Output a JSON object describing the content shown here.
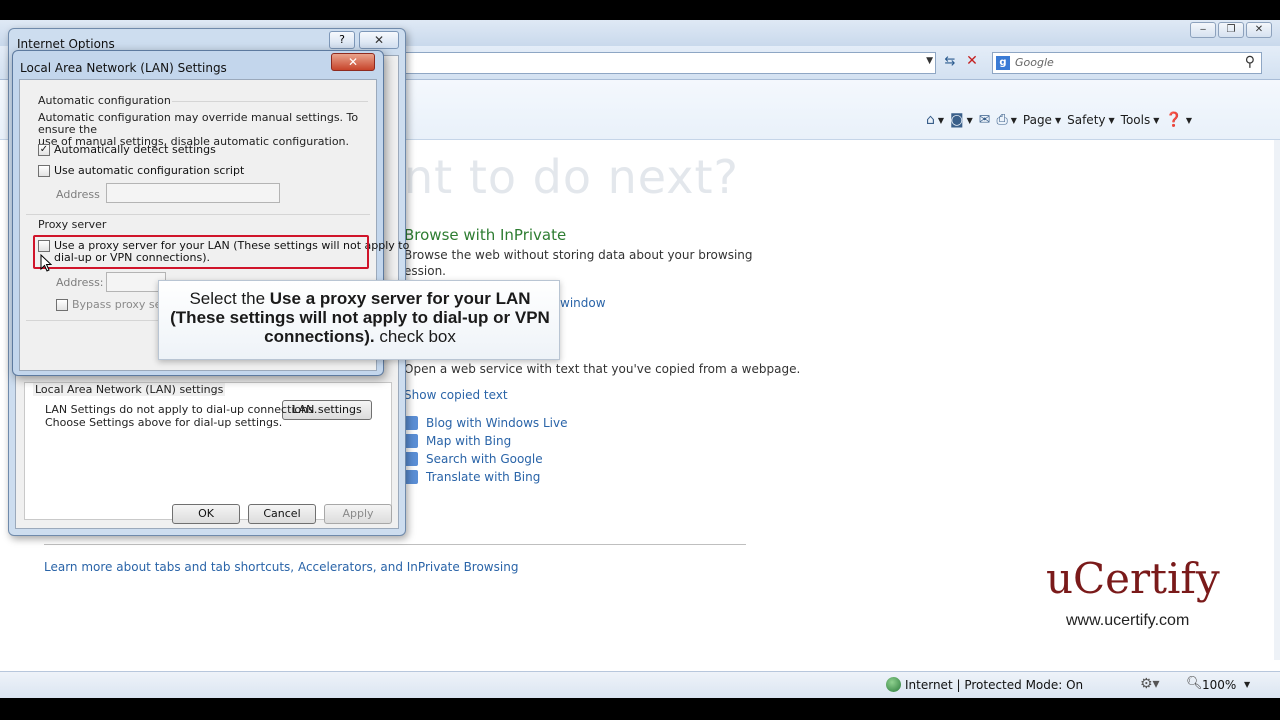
{
  "browser": {
    "search_placeholder": "Google",
    "command_bar": {
      "page_label": "Page",
      "safety_label": "Safety",
      "tools_label": "Tools"
    },
    "content": {
      "big_heading_fragment": "nt to do next?",
      "inprivate_title": "Browse with InPrivate",
      "inprivate_desc": "Browse the web without storing data about your browsing",
      "inprivate_desc_cont": "ession.",
      "window_link": "window",
      "copied_desc": "Open a web service with text that you've copied from a webpage.",
      "show_copied": "Show copied text",
      "accelerators": [
        "Blog with Windows Live",
        "Map with Bing",
        "Search with Google",
        "Translate with Bing"
      ],
      "learn_more": "Learn more about tabs and tab shortcuts, Accelerators, and InPrivate Browsing"
    },
    "status_bar": {
      "zone": "Internet | Protected Mode: On",
      "zoom": "100%"
    }
  },
  "watermark": {
    "brand": "uCertify",
    "url": "www.ucertify.com"
  },
  "internet_options": {
    "title": "Internet Options",
    "help_glyph": "?",
    "close_glyph": "✕",
    "lan_group_label": "Local Area Network (LAN) settings",
    "lan_group_text_1": "LAN Settings do not apply to dial-up connections.",
    "lan_group_text_2": "Choose Settings above for dial-up settings.",
    "lan_settings_button": "LAN settings",
    "ok": "OK",
    "cancel": "Cancel",
    "apply": "Apply"
  },
  "lan_settings": {
    "title": "Local Area Network (LAN) Settings",
    "close_glyph": "✕",
    "auto_config_label": "Automatic configuration",
    "auto_config_desc_1": "Automatic configuration may override manual settings.  To ensure the",
    "auto_config_desc_2": "use of manual settings, disable automatic configuration.",
    "auto_detect_label": "Automatically detect settings",
    "auto_detect_checked": true,
    "auto_script_label": "Use automatic configuration script",
    "auto_script_checked": false,
    "address_label": "Address",
    "proxy_label": "Proxy server",
    "use_proxy_label_1": "Use a proxy server for your LAN (These settings will not apply to",
    "use_proxy_label_2": "dial-up or VPN connections).",
    "use_proxy_checked": false,
    "proxy_address_label": "Address:",
    "bypass_label": "Bypass proxy server",
    "bypass_checked": false
  },
  "instruction": {
    "prefix": "Select the ",
    "bold": "Use a proxy server for your LAN (These settings will not apply to dial-up or VPN connections).",
    "suffix": " check box"
  },
  "colors": {
    "highlight_border": "#d0142a",
    "brand": "#7a1a1a",
    "link": "#2a64a8",
    "inprivate_title": "#2e7d32"
  }
}
